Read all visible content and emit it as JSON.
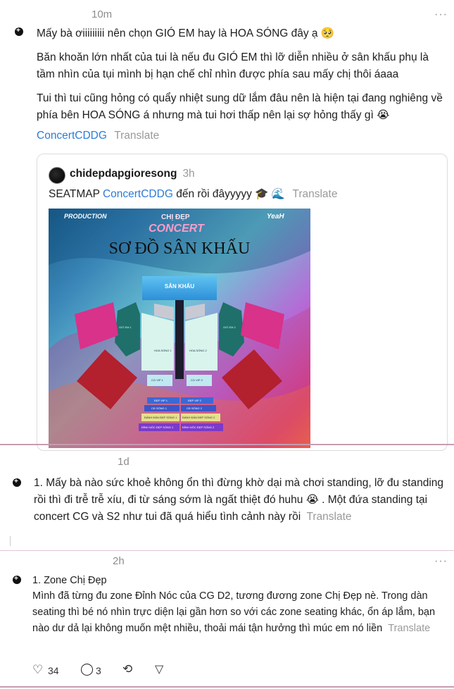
{
  "post1": {
    "time": "10m",
    "more": "···",
    "line1": "Mấy bà ơiiiiiiiii nên chọn GIÓ EM hay là HOA SÓNG đây ạ 🥺",
    "para1": "Băn khoăn lớn nhất của tui là nếu đu GIÓ EM thì lỡ diễn nhiều ở sân khấu phụ là tầm nhìn của tụi mình bị hạn chế chỉ nhìn được phía sau mấy chị thôi áaaa",
    "para2": "Tui thì tui cũng hỏng có quẩy nhiệt sung dữ lắm đâu nên là hiện tại đang nghiêng về phía bên HOA SÓNG á nhưng mà tui hơi thấp nên lại sợ hỏng thấy gì 😭",
    "tag": "ConcertCDDG",
    "translate": "Translate"
  },
  "quote": {
    "handle": "chidepdapgioresong",
    "time": "3h",
    "text_prefix": "SEATMAP",
    "tag": "ConcertCDDG",
    "text_suffix": "đến rồi đâyyyyy 🎓 🌊",
    "translate": "Translate",
    "poster": {
      "left_logo": "PRODUCTION",
      "right_logo": "YeaH",
      "brand_top": "CHỊ ĐẸP",
      "brand_bottom": "CONCERT",
      "title": "SƠ ĐỒ SÂN KHẤU",
      "stage": "SÂN KHẤU",
      "zones": {
        "hoa_song_1": "HOA SÓNG 1",
        "hoa_song_2": "HOA SÓNG 2",
        "gio_em_1": "GIÓ EM 1",
        "gio_em_2": "GIÓ EM 2",
        "cg_1": "CG VIP 1",
        "cg_2": "CG VIP 2",
        "r1": "ĐẸP VIP 1",
        "r2": "ĐẸP VIP 2",
        "r3": "CĐ SÓNG 1",
        "r4": "CĐ SÓNG 2",
        "r5": "ĐÁNH ĐÀN ĐẸP SÓNG 1",
        "r6": "ĐÁNH ĐÀN ĐẸP SÓNG 2",
        "r7": "ĐỈNH NÓC ĐẸP SÓNG 1",
        "r8": "ĐỈNH NÓC ĐẸP SÓNG 2"
      }
    }
  },
  "post2": {
    "time": "1d",
    "text": "1. Mấy bà nào sức khoẻ không ổn thì đừng khờ dại mà chơi standing, lỡ đu standing rồi thì đi trễ trễ xíu, đi từ sáng sớm là ngất thiệt đó huhu 😭 . Một đứa standing tại concert CG và S2 như tui đã quá hiểu tình cảnh này rồi",
    "translate": "Translate"
  },
  "post3": {
    "time": "2h",
    "more": "···",
    "title": "1. Zone Chị Đẹp",
    "text": "Mình đã từng đu zone Đỉnh Nóc của CG D2, tương đương zone Chị Đẹp nè. Trong dàn seating thì bé nó nhìn trực diện lại gần hơn so với các zone seating khác, ổn áp lắm, bạn nào dư dả lại không muốn mệt nhiều, thoải mái tận hưởng thì múc em nó liền",
    "translate": "Translate",
    "likes": "34",
    "replies": "3"
  }
}
